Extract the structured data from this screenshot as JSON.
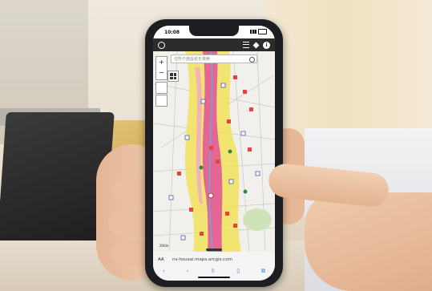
{
  "status": {
    "time": "10:08"
  },
  "search": {
    "placeholder": "住所や施設名を検索"
  },
  "map": {
    "zoom_plus": "+",
    "zoom_minus": "−",
    "scale_text": "200m"
  },
  "browser": {
    "aa_label": "AA",
    "url": "ns-housai.maps.arcgis.com",
    "nav_icons": [
      "back-icon",
      "forward-icon",
      "share-icon",
      "bookmarks-icon",
      "tabs-icon"
    ]
  },
  "colors": {
    "hazard_pink": "#e0509a",
    "hazard_yellow": "#f1e25c",
    "marker_red": "#e8423f",
    "map_background": "#f1f0ec"
  }
}
